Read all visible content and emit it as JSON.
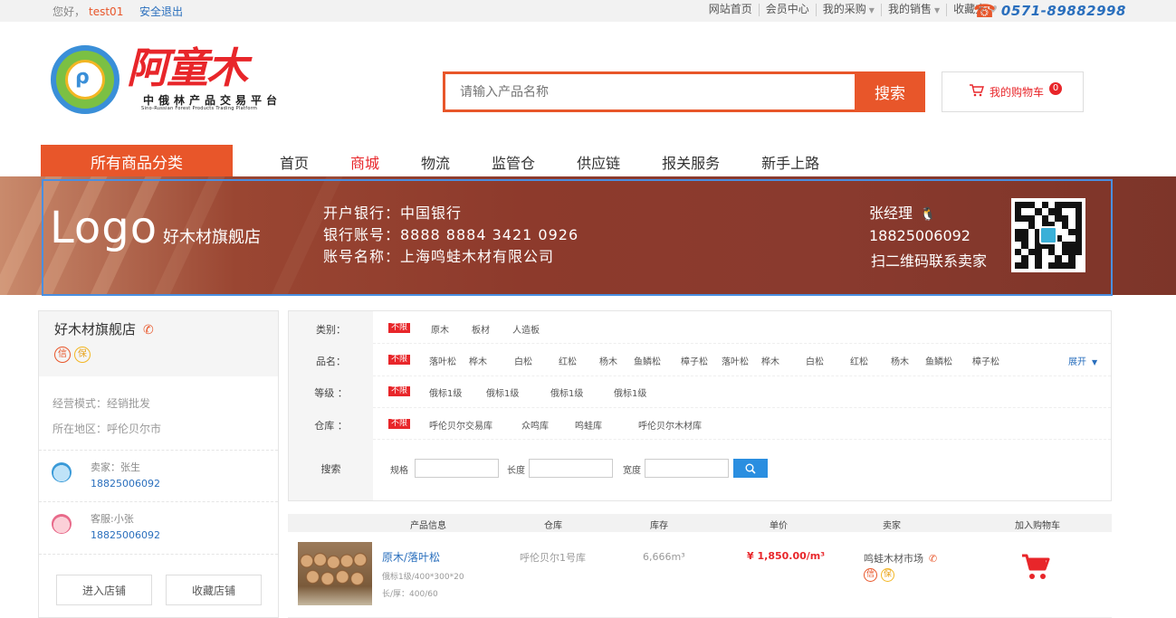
{
  "topbar": {
    "greeting": "您好，",
    "username": "test01",
    "logout": "安全退出",
    "nav": [
      "网站首页",
      "会员中心",
      "我的采购",
      "我的销售",
      "收藏夹"
    ],
    "phone": "0571-89882998"
  },
  "header": {
    "logo_title": "阿童木",
    "logo_subtitle": "中俄林产品交易平台",
    "logo_english": "Sino-Russian Forest Products Trading Platform",
    "search_placeholder": "请输入产品名称",
    "search_button": "搜索",
    "cart_label": "我的购物车",
    "cart_count": "0"
  },
  "mainnav": {
    "all_categories": "所有商品分类",
    "items": [
      "首页",
      "商城",
      "物流",
      "监管仓",
      "供应链",
      "报关服务",
      "新手上路"
    ],
    "active": "商城"
  },
  "banner": {
    "logo": "Logo",
    "shop_name": "好木材旗舰店",
    "bank": "开户银行：中国银行",
    "account": "银行账号：8888 8884 3421 0926",
    "account_name": "账号名称：上海鸣蛙木材有限公司",
    "manager": "张经理",
    "manager_phone": "18825006092",
    "scan_text": "扫二维码联系卖家"
  },
  "shop": {
    "name": "好木材旗舰店",
    "badge_credit": "信",
    "badge_guarantee": "保",
    "mode": "经营模式：经销批发",
    "region": "所在地区：呼伦贝尔市",
    "seller_role": "卖家：张生",
    "seller_phone": "18825006092",
    "service_role": "客服:小张",
    "service_phone": "18825006092",
    "enter_button": "进入店铺",
    "favorite_button": "收藏店铺"
  },
  "filter": {
    "unlimited": "不限",
    "category_label": "类别：",
    "categories": [
      "原木",
      "板材",
      "人造板"
    ],
    "species_label": "品名：",
    "species": [
      "落叶松",
      "桦木",
      "白松",
      "红松",
      "杨木",
      "鱼鳞松",
      "樟子松",
      "落叶松",
      "桦木",
      "白松",
      "红松",
      "杨木",
      "鱼鳞松",
      "樟子松"
    ],
    "expand": "展开",
    "grade_label": "等级 ：",
    "grades": [
      "俄标1级",
      "俄标1级",
      "俄标1级",
      "俄标1级"
    ],
    "warehouse_label": "仓库 ：",
    "warehouses": [
      "呼伦贝尔交易库",
      "众鸣库",
      "鸣蛙库",
      "呼伦贝尔木材库"
    ],
    "search_label": "搜索",
    "spec_label": "规格",
    "length_label": "长度",
    "width_label": "宽度"
  },
  "table": {
    "headers": [
      "产品信息",
      "仓库",
      "库存",
      "单价",
      "卖家",
      "加入购物车"
    ],
    "rows": [
      {
        "name": "原木/落叶松",
        "spec": "俄标1级/400*300*20",
        "dims": "长/厚：400/60",
        "warehouse": "呼伦贝尔1号库",
        "stock": "6,666m³",
        "price": "¥ 1,850.00/m³",
        "seller": "鸣蛙木材市场"
      }
    ]
  },
  "colors": {
    "accent": "#e8562a",
    "red": "#e8262a",
    "link": "#2a6fbd"
  }
}
